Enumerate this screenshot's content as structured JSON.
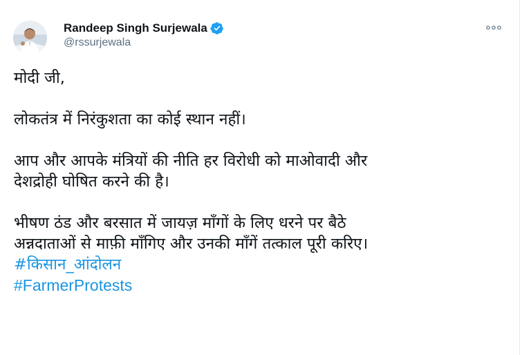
{
  "author": {
    "display_name": "Randeep Singh Surjewala",
    "handle": "@rssurjewala",
    "verified": true
  },
  "icons": {
    "verified": "verified-badge-icon",
    "more": "more-options-icon"
  },
  "colors": {
    "link": "#1b95e0",
    "verified": "#1da1f2",
    "muted": "#5b7083",
    "text": "#0f1419"
  },
  "tweet": {
    "line1": "मोदी जी,",
    "line2": "लोकतंत्र में निरंकुशता का कोई स्थान नहीं।",
    "line3a": "आप और आपके मंत्रियों की नीति हर विरोधी को माओवादी और",
    "line3b": "देशद्रोही घोषित करने की है।",
    "line4a": "भीषण ठंड और बरसात में जायज़ माँगों के लिए धरने पर बैठे",
    "line4b": "अन्नदाताओं से माफ़ी माँगिए और उनकी माँगें तत्काल पूरी करिए।",
    "hashtag1": "#किसान_आंदोलन",
    "hashtag2": "#FarmerProtests"
  }
}
